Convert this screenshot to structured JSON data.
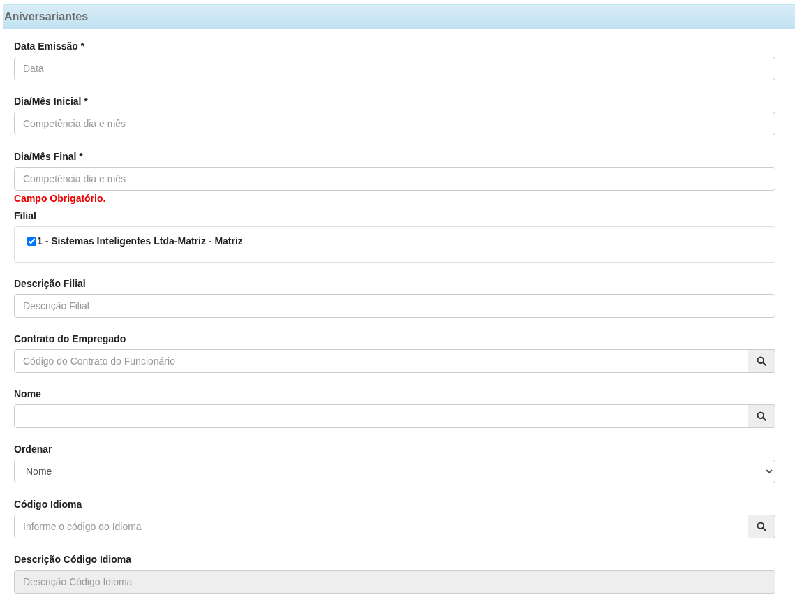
{
  "panel": {
    "title": "Aniversariantes"
  },
  "fields": [
    {
      "kind": "text",
      "label": "Data Emissão *",
      "placeholder": "Data",
      "disabled": false
    },
    {
      "kind": "text",
      "label": "Dia/Mês Inicial *",
      "placeholder": "Competência dia e mês",
      "disabled": false
    },
    {
      "kind": "text",
      "label": "Dia/Mês Final *",
      "placeholder": "Competência dia e mês",
      "disabled": false,
      "error": "Campo Obrigatório."
    },
    {
      "kind": "checkboxes",
      "label": "Filial",
      "options": [
        {
          "label": "1 - Sistemas Inteligentes Ltda-Matriz - Matriz",
          "checked": true
        }
      ]
    },
    {
      "kind": "text",
      "label": "Descrição Filial",
      "placeholder": "Descrição Filial",
      "disabled": false
    },
    {
      "kind": "search",
      "label": "Contrato do Empregado",
      "placeholder": "Código do Contrato do Funcionário"
    },
    {
      "kind": "search",
      "label": "Nome"
    },
    {
      "kind": "select",
      "label": "Ordenar",
      "value": "Nome"
    },
    {
      "kind": "search",
      "label": "Código Idioma",
      "placeholder": "Informe o código do Idioma"
    },
    {
      "kind": "text",
      "label": "Descrição Código Idioma",
      "placeholder": "Descrição Código Idioma",
      "disabled": true
    }
  ]
}
